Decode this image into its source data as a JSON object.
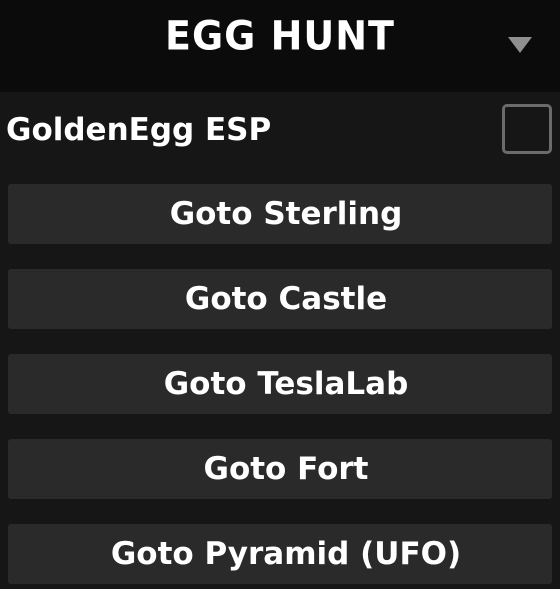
{
  "header": {
    "title": "Egg Hunt",
    "collapse_icon": "chevron-down-icon"
  },
  "toggle": {
    "label": "GoldenEgg ESP",
    "checked": false
  },
  "buttons": [
    {
      "label": "Goto Sterling"
    },
    {
      "label": "Goto Castle"
    },
    {
      "label": "Goto TeslaLab"
    },
    {
      "label": "Goto Fort"
    },
    {
      "label": "Goto Pyramid (UFO)"
    }
  ],
  "colors": {
    "header_bg": "#0b0b0b",
    "panel_bg": "#161616",
    "button_bg": "#2a2a2a",
    "text": "#ffffff",
    "checkbox_border": "#6b6b6b"
  }
}
